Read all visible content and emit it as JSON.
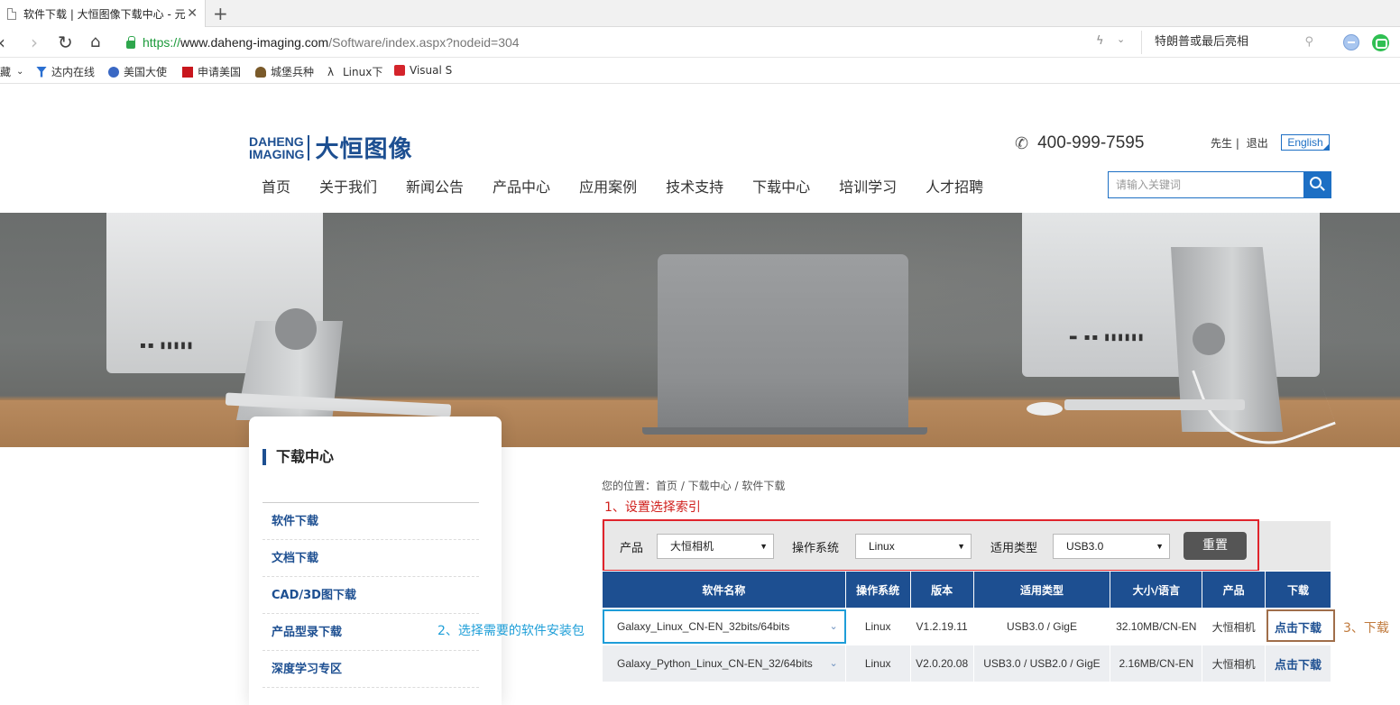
{
  "browser": {
    "tab_title": "软件下载 | 大恒图像下载中心 - 元",
    "url_proto": "https://",
    "url_host": "www.daheng-imaging.com",
    "url_path": "/Software/index.aspx?nodeid=304",
    "search_text": "特朗普或最后亮相",
    "bookmarks": [
      "藏",
      "达内在线",
      "美国大使",
      "申请美国",
      "城堡兵种",
      "Linux下",
      "Visual S"
    ]
  },
  "header": {
    "logo_en_line1": "DAHENG",
    "logo_en_line2": "IMAGING",
    "logo_cn": "大恒图像",
    "phone": "400-999-7595",
    "user_links": [
      "先生 |",
      "退出"
    ],
    "lang": "English",
    "nav": [
      "首页",
      "关于我们",
      "新闻公告",
      "产品中心",
      "应用案例",
      "技术支持",
      "下载中心",
      "培训学习",
      "人才招聘"
    ],
    "search_placeholder": "请输入关键词"
  },
  "sidebar": {
    "title": "下载中心",
    "items": [
      "软件下载",
      "文档下载",
      "CAD/3D图下载",
      "产品型录下载",
      "深度学习专区"
    ]
  },
  "breadcrumb": "您的位置：首页 / 下载中心 / 软件下载",
  "annotations": {
    "step1": "1、设置选择索引",
    "step2": "2、选择需要的软件安装包",
    "step3": "3、下载"
  },
  "filters": {
    "product_label": "产品",
    "product_value": "大恒相机",
    "os_label": "操作系统",
    "os_value": "Linux",
    "type_label": "适用类型",
    "type_value": "USB3.0",
    "reset_label": "重置"
  },
  "table": {
    "headers": [
      "软件名称",
      "操作系统",
      "版本",
      "适用类型",
      "大小/语言",
      "产品",
      "下载"
    ],
    "rows": [
      [
        "Galaxy_Linux_CN-EN_32bits/64bits",
        "Linux",
        "V1.2.19.11",
        "USB3.0 / GigE",
        "32.10MB/CN-EN",
        "大恒相机",
        "点击下载"
      ],
      [
        "Galaxy_Python_Linux_CN-EN_32/64bits",
        "Linux",
        "V2.0.20.08",
        "USB3.0 / USB2.0 / GigE",
        "2.16MB/CN-EN",
        "大恒相机",
        "点击下载"
      ]
    ]
  },
  "colors": {
    "brand_blue": "#1d4f91",
    "step1_red": "#d0201d",
    "step2_blue": "#1f9fd8",
    "step3_brown": "#c07a3d"
  }
}
